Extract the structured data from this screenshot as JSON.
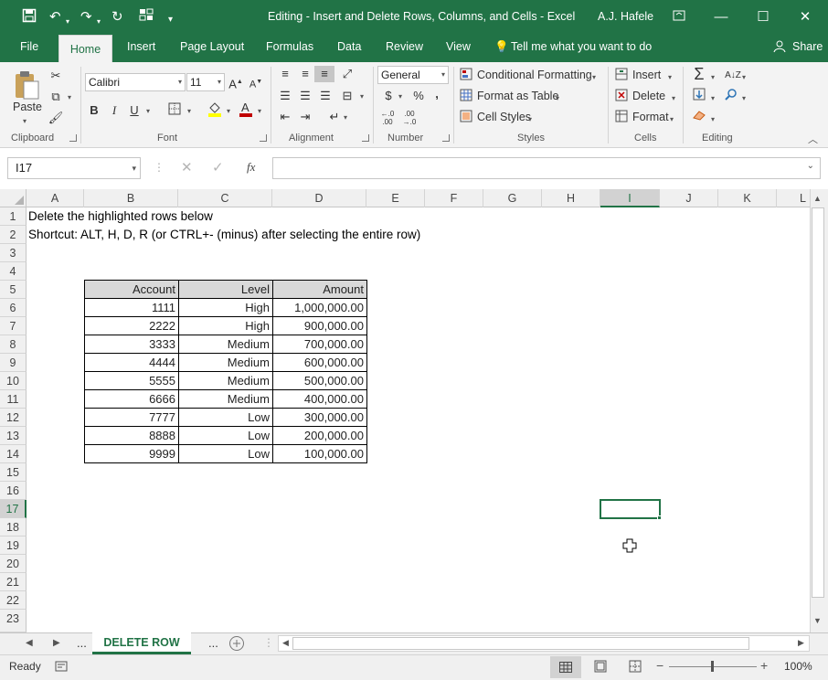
{
  "title": {
    "document": "Editing - Insert and Delete Rows, Columns, and Cells  -  Excel",
    "user": "A.J. Hafele"
  },
  "ribbon_tabs": [
    "File",
    "Home",
    "Insert",
    "Page Layout",
    "Formulas",
    "Data",
    "Review",
    "View"
  ],
  "tell_me": "Tell me what you want to do",
  "share": "Share",
  "clipboard": {
    "paste": "Paste",
    "label": "Clipboard"
  },
  "font": {
    "name": "Calibri",
    "size": "11",
    "label": "Font",
    "bold": "B",
    "italic": "I",
    "underline": "U"
  },
  "alignment": {
    "label": "Alignment"
  },
  "number": {
    "format": "General",
    "label": "Number",
    "currency": "$",
    "percent": "%",
    "comma": ","
  },
  "styles": {
    "conditional": "Conditional Formatting",
    "table": "Format as Table",
    "cell_styles": "Cell Styles",
    "label": "Styles"
  },
  "cells": {
    "insert": "Insert",
    "delete": "Delete",
    "format": "Format",
    "label": "Cells"
  },
  "editing": {
    "label": "Editing"
  },
  "formula_bar": {
    "name_box": "I17",
    "fx": "fx",
    "value": ""
  },
  "columns": [
    "A",
    "B",
    "C",
    "D",
    "E",
    "F",
    "G",
    "H",
    "I",
    "J",
    "K",
    "L"
  ],
  "rows": [
    "1",
    "2",
    "3",
    "4",
    "5",
    "6",
    "7",
    "8",
    "9",
    "10",
    "11",
    "12",
    "13",
    "14",
    "15",
    "16",
    "17",
    "18",
    "19",
    "20",
    "21",
    "22",
    "23"
  ],
  "cells_text": {
    "a1": "Delete the highlighted rows below",
    "a2": "Shortcut: ALT, H, D, R (or CTRL+- (minus) after selecting the entire row)"
  },
  "table": {
    "headers": [
      "Account",
      "Level",
      "Amount"
    ],
    "rows": [
      [
        "1111",
        "High",
        "1,000,000.00"
      ],
      [
        "2222",
        "High",
        "900,000.00"
      ],
      [
        "3333",
        "Medium",
        "700,000.00"
      ],
      [
        "4444",
        "Medium",
        "600,000.00"
      ],
      [
        "5555",
        "Medium",
        "500,000.00"
      ],
      [
        "6666",
        "Medium",
        "400,000.00"
      ],
      [
        "7777",
        "Low",
        "300,000.00"
      ],
      [
        "8888",
        "Low",
        "200,000.00"
      ],
      [
        "9999",
        "Low",
        "100,000.00"
      ]
    ]
  },
  "sheet_tabs": {
    "ellipsis": "...",
    "active": "DELETE ROW"
  },
  "status": {
    "ready": "Ready",
    "zoom": "100%"
  },
  "colors": {
    "accent": "#217346",
    "selected_border": "#217346"
  }
}
